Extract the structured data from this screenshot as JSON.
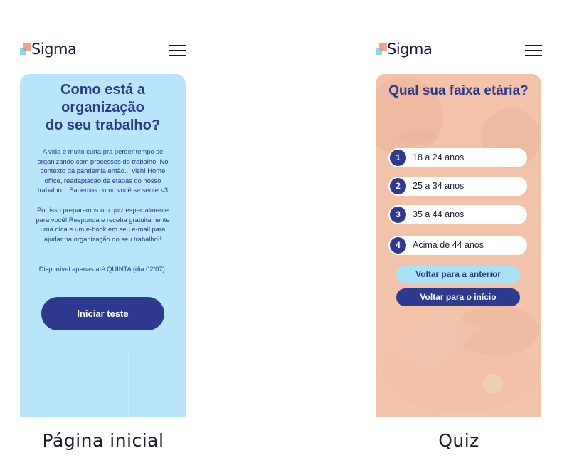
{
  "screens": {
    "home": {
      "logo_text": "Sigma",
      "title_lines": [
        "Como está a",
        "organização",
        "do seu trabalho?"
      ],
      "paragraph1": "A vida é muito curta pra perder tempo se organizando com processos do trabalho. No contexto da pandemia então... vish! Home office, readaptação de etapas do nosso trabalho... Sabemos como você se sente <3",
      "paragraph2": "Por isso preparamos um quiz especialmente para você! Responda e receba gratuitamente uma dica e um e-book em seu e-mail para ajudar na organização do seu trabalho!!",
      "availability": "Disponível apenas até QUINTA (dia 02/07).",
      "start_button": "Iniciar teste",
      "caption": "Página inicial"
    },
    "quiz": {
      "logo_text": "Sigma",
      "question": "Qual sua faixa etária?",
      "options": [
        {
          "number": "1",
          "label": "18 a 24 anos"
        },
        {
          "number": "2",
          "label": "25 a 34 anos"
        },
        {
          "number": "3",
          "label": "35 a 44 anos"
        },
        {
          "number": "4",
          "label": "Acima de 44 anos"
        }
      ],
      "back_button": "Voltar para a anterior",
      "home_button": "Voltar para o início",
      "caption": "Quiz"
    }
  },
  "icons": {
    "menu": "hamburger-menu-icon",
    "logo": "sigma-logo-squares"
  },
  "colors": {
    "navy": "#2d3a8f",
    "light_blue": "#b8e5fa",
    "peach": "#f3c3a9",
    "accent_blue": "#a9e1f5"
  }
}
